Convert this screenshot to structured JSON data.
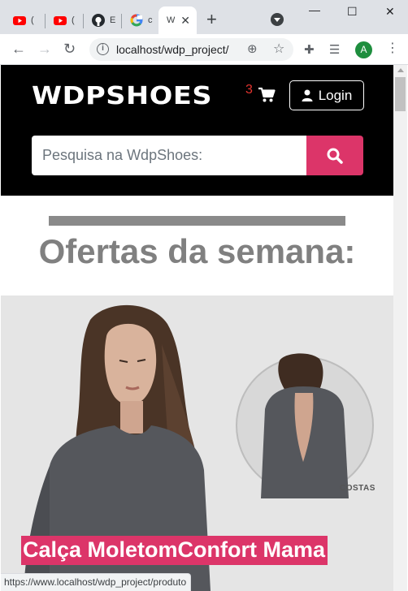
{
  "browser": {
    "tabs": [
      {
        "title": "(",
        "icon": "youtube-icon"
      },
      {
        "title": "(",
        "icon": "youtube-icon"
      },
      {
        "title": "E",
        "icon": "github-icon"
      },
      {
        "title": "c",
        "icon": "google-icon"
      },
      {
        "title": "W",
        "icon": "page-icon",
        "active": true
      }
    ],
    "url": "localhost/wdp_project/",
    "profile_initial": "A",
    "status_url": "https://www.localhost/wdp_project/produto"
  },
  "site": {
    "logo": "WDPSHOES",
    "cart_count": "3",
    "login_label": "Login",
    "search_placeholder": "Pesquisa na WdpShoes:"
  },
  "offers": {
    "title": "Ofertas da semana:"
  },
  "banner": {
    "back_label": "COSTAS",
    "caption": "Calça MoletomConfort Mama"
  },
  "colors": {
    "accent": "#dc3569",
    "header_bg": "#000000",
    "cart_count": "#e3342f",
    "title_gray": "#808080"
  }
}
